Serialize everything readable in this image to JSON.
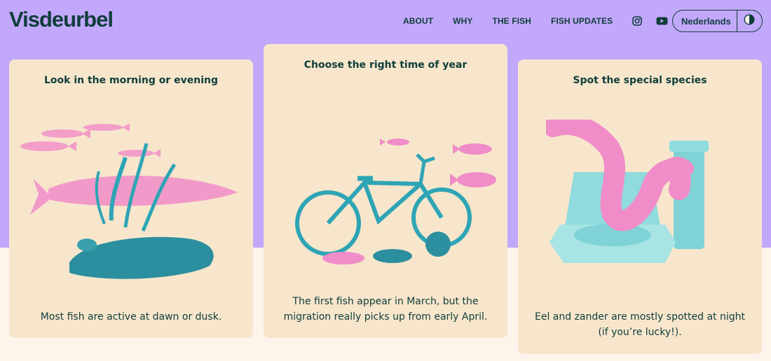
{
  "header": {
    "logo": "Visdeurbel",
    "nav": [
      "ABOUT",
      "WHY",
      "THE FISH",
      "FISH UPDATES"
    ],
    "icons": [
      "instagram-icon",
      "youtube-icon"
    ],
    "language": "Nederlands",
    "theme_toggle_icon": "contrast-icon"
  },
  "colors": {
    "purple": "#c2a8fb",
    "cream": "#fdf4ec",
    "card": "#f7e6cc",
    "dark_green": "#0f3d3a",
    "pink": "#f08cc8",
    "teal": "#2ea5b5"
  },
  "cards": [
    {
      "title": "Look in the morning or evening",
      "text": "Most fish are active at dawn or dusk.",
      "illustration": "pike-and-driftwood"
    },
    {
      "title": "Choose the right time of year",
      "text": "The first fish appear in March, but the migration really picks up from early April.",
      "illustration": "bicycle-with-fish"
    },
    {
      "title": "Spot the special species",
      "text": "Eel and zander are mostly spotted at night (if you’re lucky!).",
      "illustration": "eel-and-ruins"
    }
  ]
}
